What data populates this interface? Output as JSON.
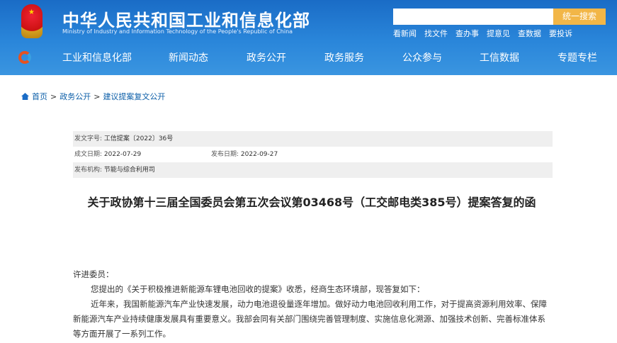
{
  "header": {
    "title_cn": "中华人民共和国工业和信息化部",
    "title_en": "Ministry of Industry and Information Technology of the People's Republic of China",
    "search_placeholder": "",
    "search_button": "统一搜索",
    "quick_links": [
      "看新闻",
      "找文件",
      "查办事",
      "提意见",
      "查数据",
      "要投诉"
    ]
  },
  "nav": [
    "工业和信息化部",
    "新闻动态",
    "政务公开",
    "政务服务",
    "公众参与",
    "工信数据",
    "专题专栏"
  ],
  "breadcrumb": [
    "首页",
    "政务公开",
    "建议提案复文公开"
  ],
  "info": {
    "doc_no_label": "发文字号:",
    "doc_no": "工信提案〔2022〕36号",
    "written_label": "成文日期:",
    "written": "2022-07-29",
    "published_label": "发布日期:",
    "published": "2022-09-27",
    "org_label": "发布机构:",
    "org": "节能与综合利用司"
  },
  "article": {
    "title": "关于政协第十三届全国委员会第五次会议第03468号（工交邮电类385号）提案答复的函",
    "salutation": "许进委员：",
    "p1": "您提出的《关于积极推进新能源车锂电池回收的提案》收悉，经商生态环境部，现答复如下：",
    "p2": "近年来，我国新能源汽车产业快速发展，动力电池退役量逐年增加。做好动力电池回收利用工作，对于提高资源利用效率、保障新能源汽车产业持续健康发展具有重要意义。我部会同有关部门围绕完善管理制度、实施信息化溯源、加强技术创新、完善标准体系等方面开展了一系列工作。"
  }
}
